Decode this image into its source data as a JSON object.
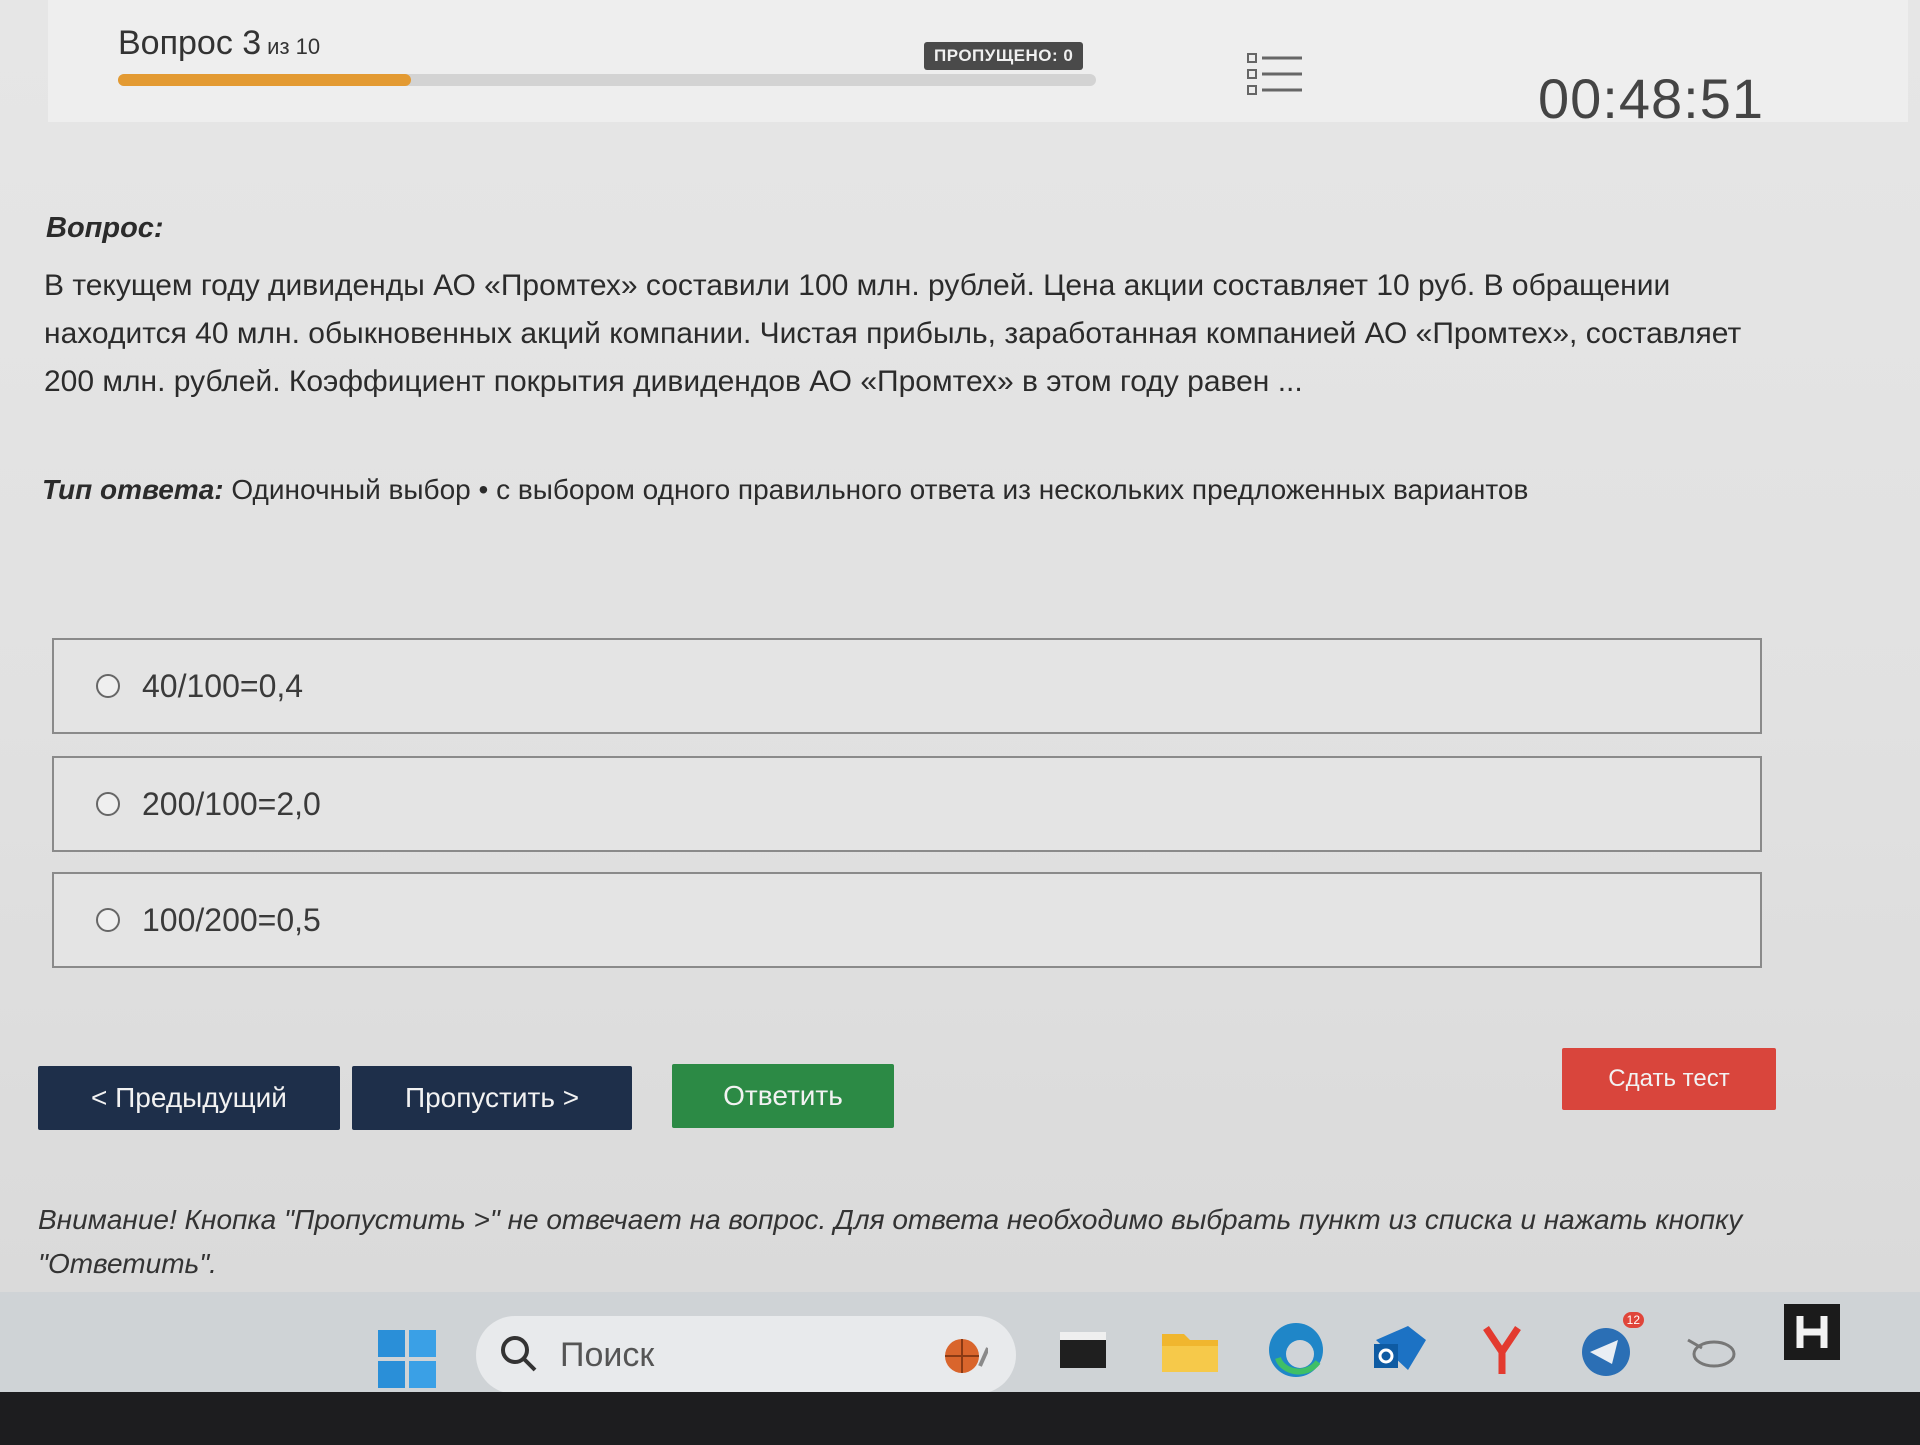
{
  "header": {
    "question_label": "Вопрос 3",
    "question_of": "из 10",
    "progress_fraction": 0.3,
    "skipped_label": "пропущено: 0",
    "timer": "00:48:51",
    "list_icon": "question-list-icon"
  },
  "question": {
    "label": "Вопрос:",
    "text": "В текущем году дивиденды АО «Промтех» составили 100 млн. рублей. Цена акции составляет 10 руб. В обращении находится 40 млн. обыкновенных акций компании. Чистая прибыль, заработанная компанией АО «Промтех», составляет 200 млн. рублей. Коэффициент покрытия дивидендов АО «Промтех» в этом году равен ...",
    "answer_type_label": "Тип ответа:",
    "answer_type_text": "Одиночный выбор • с выбором одного правильного ответа из нескольких предложенных вариантов"
  },
  "options": [
    {
      "text": "40/100=0,4"
    },
    {
      "text": "200/100=2,0"
    },
    {
      "text": "100/200=0,5"
    }
  ],
  "buttons": {
    "prev": "< Предыдущий",
    "skip": "Пропустить >",
    "answer": "Ответить",
    "submit": "Сдать тест"
  },
  "warning": "Внимание! Кнопка \"Пропустить >\" не отвечает на вопрос. Для ответа необходимо выбрать пункт из списка и нажать кнопку \"Ответить\".",
  "taskbar": {
    "search_placeholder": "Поиск",
    "mail_badge": "12",
    "icons": [
      "windows-start-icon",
      "search-icon",
      "terminal-icon",
      "folder-icon",
      "edge-icon",
      "outlook-icon",
      "yandex-browser-icon",
      "mail-icon",
      "mouse-icon",
      "app-h-icon"
    ]
  },
  "colors": {
    "progress": "#e39a32",
    "nav_button": "#1e2f4a",
    "answer_button": "#2c8a45",
    "submit_button": "#d9453c"
  }
}
